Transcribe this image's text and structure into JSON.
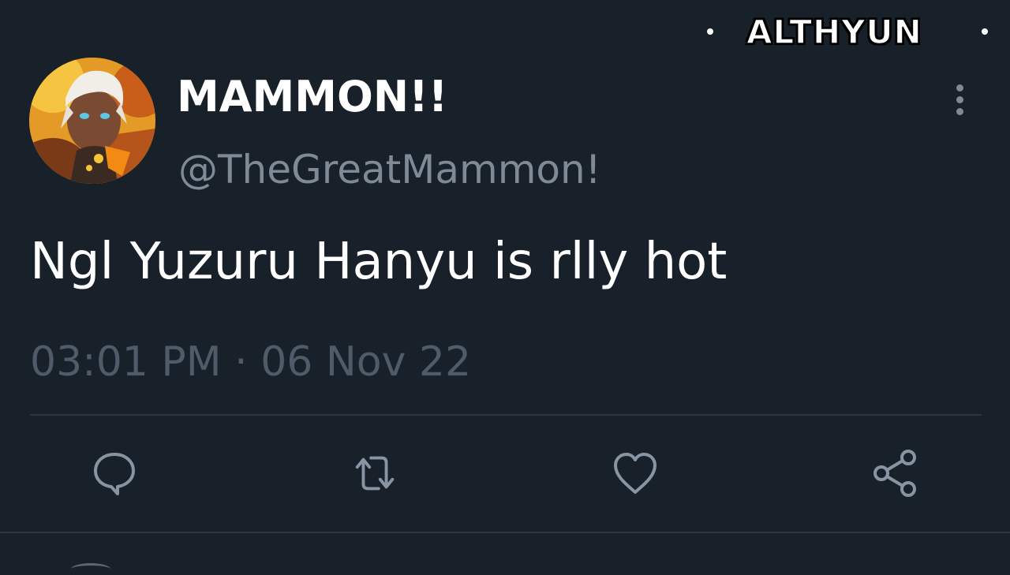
{
  "watermark": {
    "text": "ALTHYUN"
  },
  "tweet": {
    "author": {
      "display_name": "MAMMON!!",
      "handle": "@TheGreatMammon!",
      "avatar": "avatar-illustration"
    },
    "text": "Ngl Yuzuru Hanyu is rlly hot",
    "timestamp": "03:01 PM · 06 Nov 22"
  },
  "actions": [
    {
      "icon": "reply-icon"
    },
    {
      "icon": "retweet-icon"
    },
    {
      "icon": "like-icon"
    },
    {
      "icon": "share-icon"
    }
  ],
  "colors": {
    "background": "#18202a",
    "primary_text": "#ffffff",
    "secondary_text": "#7f8a96",
    "muted_text": "#4f5b68",
    "icon": "#8795a3",
    "divider": "#2c3641"
  }
}
